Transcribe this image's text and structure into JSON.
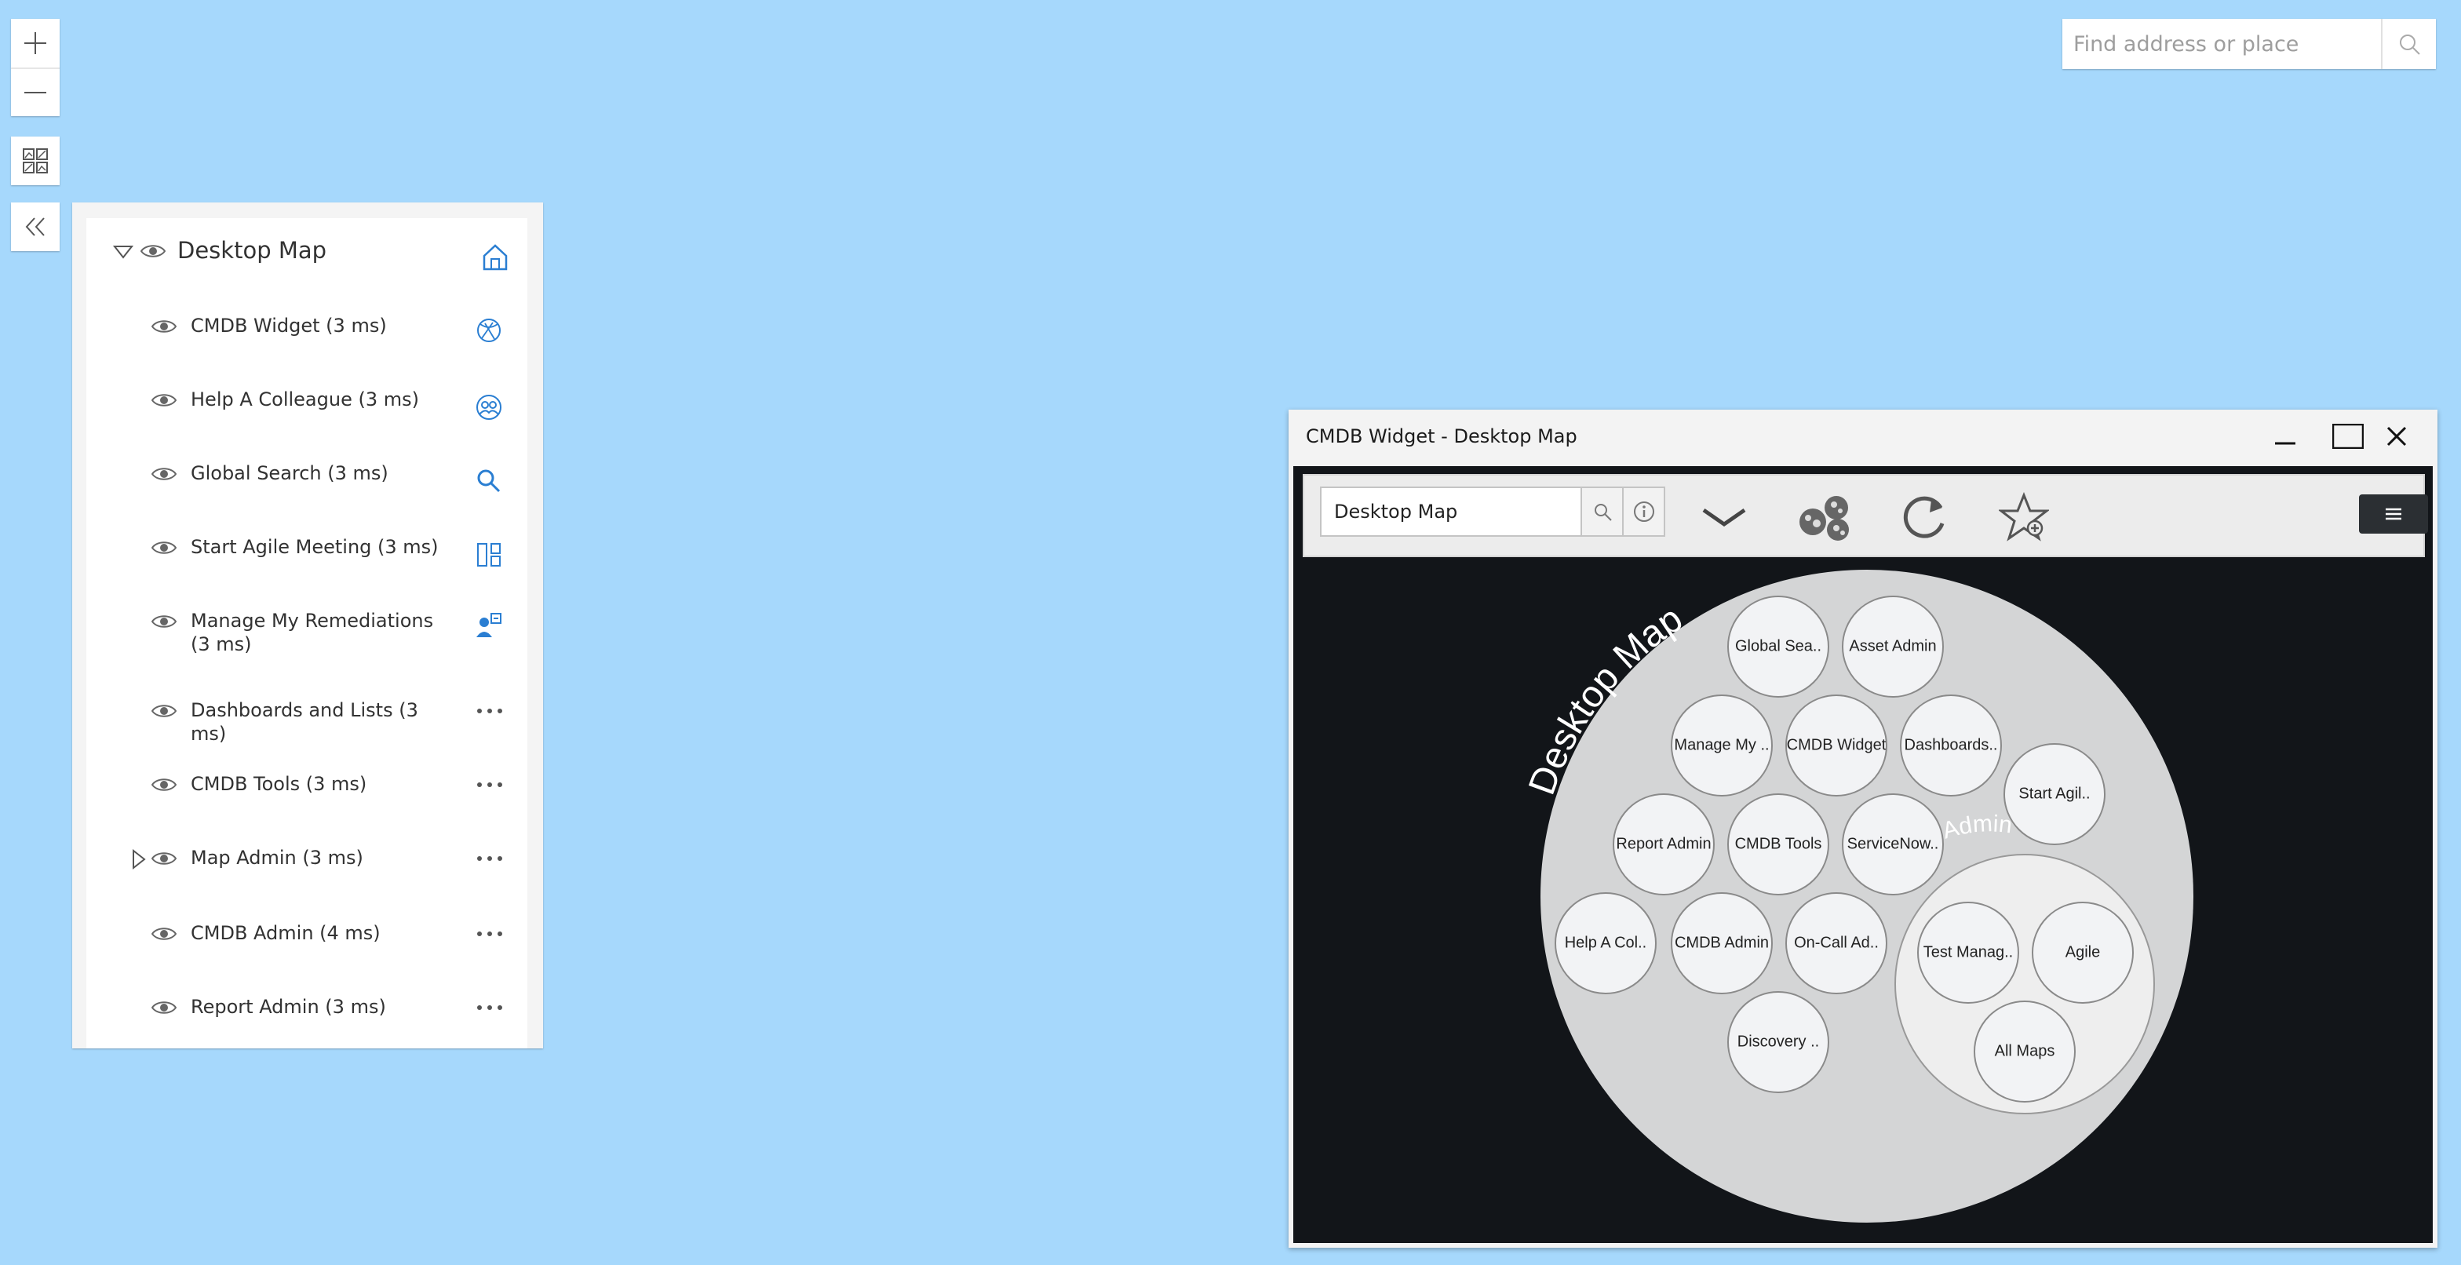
{
  "map_controls": {
    "zoom_in_icon": "plus-icon",
    "zoom_out_icon": "minus-icon",
    "basemap_icon": "basemap-gallery-icon",
    "collapse_icon": "double-chevron-left-icon"
  },
  "search": {
    "placeholder": "Find address or place",
    "icon": "search-icon"
  },
  "layer_list": {
    "root": {
      "title": "Desktop Map",
      "action_icon": "home-icon"
    },
    "layers": [
      {
        "label": "CMDB Widget (3 ms)",
        "action_icon": "globe-icon",
        "expandable": false
      },
      {
        "label": "Help A Colleague (3 ms)",
        "action_icon": "people-icon",
        "expandable": false
      },
      {
        "label": "Global Search (3 ms)",
        "action_icon": "search-icon",
        "expandable": false
      },
      {
        "label": "Start Agile Meeting (3 ms)",
        "action_icon": "columns-icon",
        "expandable": false
      },
      {
        "label": "Manage My Remediations (3 ms)",
        "action_icon": "person-badge-icon",
        "expandable": false
      },
      {
        "label": "Dashboards and Lists (3 ms)",
        "action_icon": "more-icon",
        "expandable": false
      },
      {
        "label": "CMDB Tools (3 ms)",
        "action_icon": "more-icon",
        "expandable": false
      },
      {
        "label": "Map Admin (3 ms)",
        "action_icon": "more-icon",
        "expandable": true
      },
      {
        "label": "CMDB Admin (4 ms)",
        "action_icon": "more-icon",
        "expandable": false
      },
      {
        "label": "Report Admin (3 ms)",
        "action_icon": "more-icon",
        "expandable": false
      }
    ]
  },
  "widget": {
    "title": "CMDB Widget - Desktop Map",
    "toolbar": {
      "search_value": "Desktop Map",
      "icons": [
        "search-icon",
        "info-icon",
        "chevron-down-icon",
        "cluster-icon",
        "refresh-icon",
        "favorite-add-icon",
        "hamburger-menu-icon"
      ]
    },
    "visualization": {
      "root_label": "Desktop Map",
      "group_label": "Map Admin",
      "bubbles": [
        "Global Sea..",
        "Asset Admin",
        "Manage My ..",
        "CMDB Widget",
        "Dashboards..",
        "Start Agil..",
        "Report Admin",
        "CMDB Tools",
        "ServiceNow..",
        "Help A Col..",
        "CMDB Admin",
        "On-Call Ad..",
        "Discovery .."
      ],
      "group_bubbles": [
        "Test Manag..",
        "Agile",
        "All Maps"
      ]
    }
  }
}
